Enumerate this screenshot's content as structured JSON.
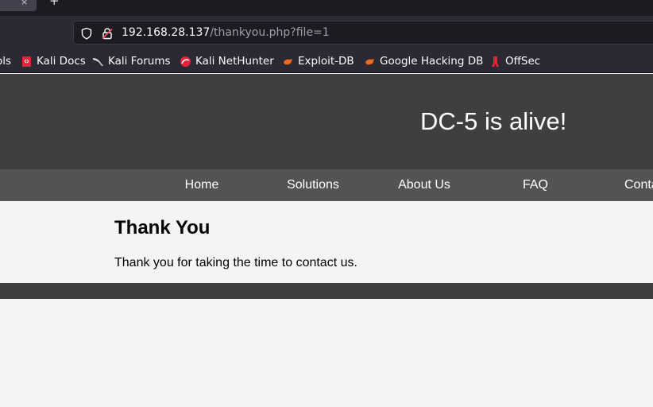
{
  "browser": {
    "tab_close_glyph": "×",
    "new_tab_glyph": "+",
    "url_host": "192.168.28.137",
    "url_path": "/thankyou.php?file=1",
    "bookmarks": [
      {
        "label": "ols",
        "icon": "kali-tools-icon"
      },
      {
        "label": "Kali Docs",
        "icon": "kali-docs-icon"
      },
      {
        "label": "Kali Forums",
        "icon": "kali-dragon-icon"
      },
      {
        "label": "Kali NetHunter",
        "icon": "nethunter-icon"
      },
      {
        "label": "Exploit-DB",
        "icon": "exploit-db-icon"
      },
      {
        "label": "Google Hacking DB",
        "icon": "ghdb-icon"
      },
      {
        "label": "OffSec",
        "icon": "offsec-icon"
      }
    ]
  },
  "site": {
    "title": "DC-5 is alive!",
    "nav": [
      "Home",
      "Solutions",
      "About Us",
      "FAQ",
      "Conta"
    ],
    "heading": "Thank You",
    "message": "Thank you for taking the time to contact us."
  },
  "colors": {
    "header_bg": "#3f3f3f",
    "nav_bg": "#535353",
    "content_bg": "#f4f4f4",
    "browser_bg": "#2b2a33"
  }
}
